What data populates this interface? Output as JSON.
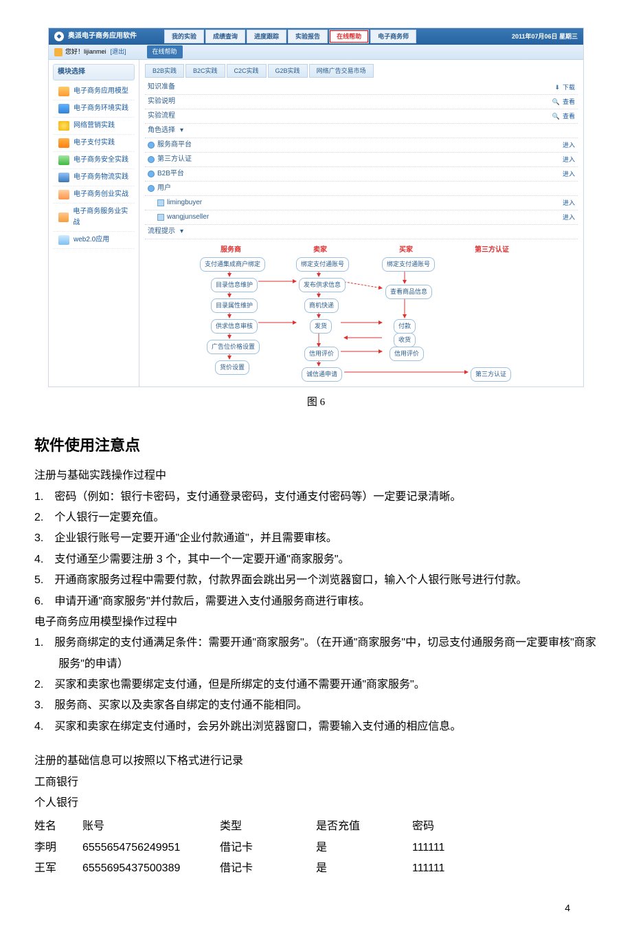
{
  "app": {
    "title": "奥派电子商务应用软件",
    "date": "2011年07月06日  星期三",
    "greeting_prefix": "您好！",
    "user": "lijianmei",
    "logout": "[退出]",
    "online_help_btn": "在线帮助",
    "top_tabs": [
      "我的实验",
      "成绩查询",
      "进度跟踪",
      "实验报告",
      "在线帮助",
      "电子商务师"
    ]
  },
  "sidebar": {
    "title": "模块选择",
    "items": [
      {
        "label": "电子商务应用模型",
        "cls": "ic-cart"
      },
      {
        "label": "电子商务环境实践",
        "cls": "ic-env"
      },
      {
        "label": "网络营销实践",
        "cls": "ic-net"
      },
      {
        "label": "电子支付实践",
        "cls": "ic-pay"
      },
      {
        "label": "电子商务安全实践",
        "cls": "ic-safe"
      },
      {
        "label": "电子商务物流实践",
        "cls": "ic-log"
      },
      {
        "label": "电子商务创业实战",
        "cls": "ic-biz"
      },
      {
        "label": "电子商务服务业实战",
        "cls": "ic-svc"
      },
      {
        "label": "web2.0应用",
        "cls": "ic-w20"
      }
    ]
  },
  "sub_tabs": [
    "B2B实践",
    "B2C实践",
    "C2C实践",
    "G2B实践",
    "网络广告交易市场"
  ],
  "rows": {
    "r1": {
      "label": "知识准备",
      "act": "下载",
      "act_cls": "dl-icon"
    },
    "r2": {
      "label": "实验说明",
      "act": "查看",
      "act_cls": "mag-icon"
    },
    "r3": {
      "label": "实验流程",
      "act": "查看",
      "act_cls": "mag-icon"
    },
    "r4": {
      "label": "角色选择"
    },
    "r5": {
      "label": "服务商平台",
      "act": "进入"
    },
    "r6": {
      "label": "第三方认证",
      "act": "进入"
    },
    "r7": {
      "label": "B2B平台",
      "act": "进入"
    },
    "r8": {
      "label": "用户"
    },
    "r9": {
      "label": "limingbuyer",
      "act": "进入"
    },
    "r10": {
      "label": "wangjunseller",
      "act": "进入"
    },
    "r11": {
      "label": "流程提示"
    }
  },
  "flow": {
    "heads": {
      "h1": "服务商",
      "h2": "卖家",
      "h3": "买家",
      "h4": "第三方认证"
    },
    "b1": "支付通集成商户绑定",
    "b2": "绑定支付通账号",
    "b3": "绑定支付通账号",
    "b4": "目录信息维护",
    "b5": "发布供求信息",
    "b6": "查看商品信息",
    "b7": "目录属性维护",
    "b8": "商机快递",
    "b9": "供求信息审核",
    "b10": "发货",
    "b11": "付款",
    "b12": "广告位价格设置",
    "b13": "收货",
    "b14": "信用评价",
    "b15": "信用评价",
    "b16": "货价设置",
    "b17": "诚信通申请",
    "b18": "第三方认证"
  },
  "fig_caption": "图 6",
  "doc": {
    "h2": "软件使用注意点",
    "p_intro1": "注册与基础实践操作过程中",
    "ol1": [
      "密码（例如：银行卡密码，支付通登录密码，支付通支付密码等）一定要记录清晰。",
      "个人银行一定要充值。",
      "企业银行账号一定要开通\"企业付款通道\"，并且需要审核。",
      "支付通至少需要注册 3 个，其中一个一定要开通\"商家服务\"。",
      "开通商家服务过程中需要付款，付款界面会跳出另一个浏览器窗口，输入个人银行账号进行付款。",
      "申请开通\"商家服务\"并付款后，需要进入支付通服务商进行审核。"
    ],
    "p_intro2": "电子商务应用模型操作过程中",
    "ol2": [
      "服务商绑定的支付通满足条件：需要开通\"商家服务\"。（在开通\"商家服务\"中，切忌支付通服务商一定要审核\"商家服务\"的申请）",
      "买家和卖家也需要绑定支付通，但是所绑定的支付通不需要开通\"商家服务\"。",
      "服务商、买家以及卖家各自绑定的支付通不能相同。",
      "买家和卖家在绑定支付通时，会另外跳出浏览器窗口，需要输入支付通的相应信息。"
    ],
    "p_reg": "注册的基础信息可以按照以下格式进行记录",
    "bank1": "工商银行",
    "bank2": "个人银行",
    "table": {
      "head": {
        "c1": "姓名",
        "c2": "账号",
        "c3": "类型",
        "c4": "是否充值",
        "c5": "密码"
      },
      "rows": [
        {
          "c1": "李明",
          "c2": "6555654756249951",
          "c3": "借记卡",
          "c4": "是",
          "c5": "111111"
        },
        {
          "c1": "王军",
          "c2": "6555695437500389",
          "c3": "借记卡",
          "c4": "是",
          "c5": "111111"
        }
      ]
    }
  },
  "page_num": "4"
}
